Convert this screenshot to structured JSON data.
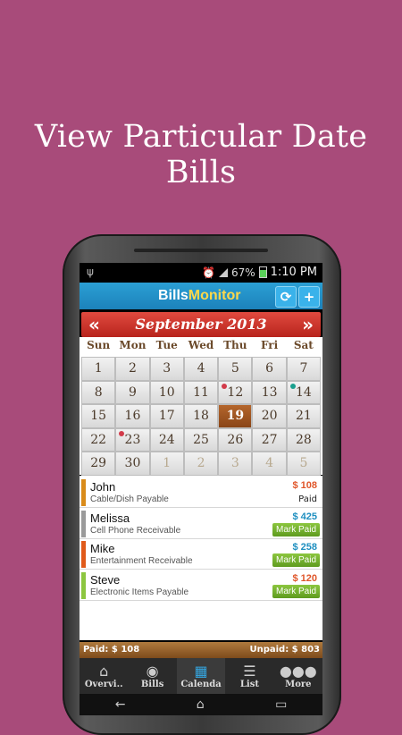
{
  "headline": "View Particular Date Bills",
  "status_bar": {
    "battery": "67%",
    "time": "1:10 PM"
  },
  "app": {
    "logo_part1": "Bills",
    "logo_part2": "Monitor",
    "sync_icon": "sync-icon",
    "add_icon": "plus-icon"
  },
  "calendar": {
    "month_title": "September 2013",
    "prev_label": "«",
    "next_label": "»",
    "weekdays": [
      "Sun",
      "Mon",
      "Tue",
      "Wed",
      "Thu",
      "Fri",
      "Sat"
    ],
    "days": [
      {
        "d": "1"
      },
      {
        "d": "2"
      },
      {
        "d": "3"
      },
      {
        "d": "4"
      },
      {
        "d": "5"
      },
      {
        "d": "6"
      },
      {
        "d": "7"
      },
      {
        "d": "8"
      },
      {
        "d": "9"
      },
      {
        "d": "10"
      },
      {
        "d": "11"
      },
      {
        "d": "12",
        "dot": "#d23b4a"
      },
      {
        "d": "13"
      },
      {
        "d": "14",
        "dot": "#1aa08e"
      },
      {
        "d": "15"
      },
      {
        "d": "16"
      },
      {
        "d": "17"
      },
      {
        "d": "18"
      },
      {
        "d": "19",
        "selected": true
      },
      {
        "d": "20"
      },
      {
        "d": "21"
      },
      {
        "d": "22"
      },
      {
        "d": "23",
        "dot": "#d23b4a"
      },
      {
        "d": "24"
      },
      {
        "d": "25"
      },
      {
        "d": "26"
      },
      {
        "d": "27"
      },
      {
        "d": "28"
      },
      {
        "d": "29"
      },
      {
        "d": "30"
      },
      {
        "d": "1",
        "other": true
      },
      {
        "d": "2",
        "other": true
      },
      {
        "d": "3",
        "other": true
      },
      {
        "d": "4",
        "other": true
      },
      {
        "d": "5",
        "other": true
      }
    ]
  },
  "bills": [
    {
      "name": "John",
      "sub": "Cable/Dish  Payable",
      "amount": "$ 108",
      "amount_color": "#e0562a",
      "status": "Paid",
      "bar": "#d98b1a"
    },
    {
      "name": "Melissa",
      "sub": "Cell Phone  Receivable",
      "amount": "$ 425",
      "amount_color": "#1e8fc0",
      "action": "Mark Paid",
      "bar": "#9a9a9a"
    },
    {
      "name": "Mike",
      "sub": "Entertainment  Receivable",
      "amount": "$ 258",
      "amount_color": "#1e8fc0",
      "action": "Mark Paid",
      "bar": "#e05a1a"
    },
    {
      "name": "Steve",
      "sub": "Electronic Items  Payable",
      "amount": "$ 120",
      "amount_color": "#e0562a",
      "action": "Mark Paid",
      "bar": "#8cc63f"
    }
  ],
  "totals": {
    "paid": "Paid: $ 108",
    "unpaid": "Unpaid: $ 803"
  },
  "tabs": [
    {
      "label": "Overvi..",
      "icon": "home-icon",
      "glyph": "⌂"
    },
    {
      "label": "Bills",
      "icon": "eye-icon",
      "glyph": "◉"
    },
    {
      "label": "Calenda",
      "icon": "calendar-icon",
      "glyph": "▦",
      "active": true
    },
    {
      "label": "List",
      "icon": "list-icon",
      "glyph": "☰"
    },
    {
      "label": "More",
      "icon": "more-icon",
      "glyph": "●●●"
    }
  ],
  "system_nav": {
    "back": "←",
    "home": "⌂",
    "recent": "▭"
  }
}
